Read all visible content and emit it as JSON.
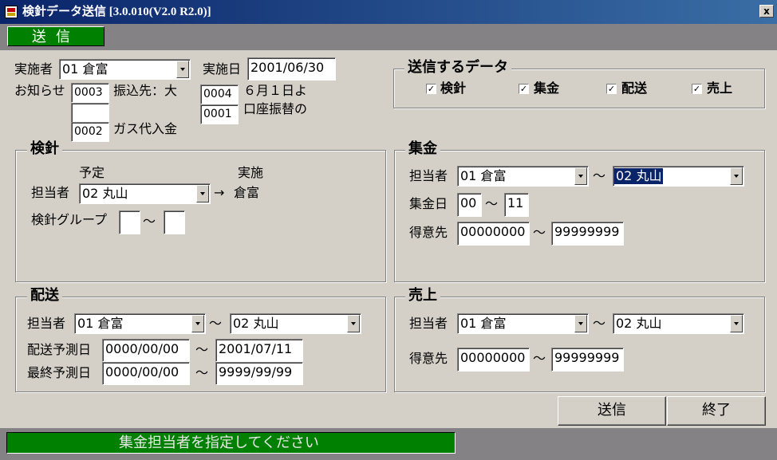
{
  "window": {
    "title": "検針データ送信 [3.0.010(V2.0 R2.0)]",
    "close_label": "x"
  },
  "toolbar": {
    "tab_label": "送信"
  },
  "header": {
    "executor_label": "実施者",
    "executor_value": "01 倉富",
    "date_label": "実施日",
    "date_value": "2001/06/30",
    "notice_label": "お知らせ",
    "notices": [
      {
        "code": "0003",
        "text": "振込先：大"
      },
      {
        "code": "",
        "text": ""
      },
      {
        "code": "0002",
        "text": "ガス代入金"
      }
    ],
    "notices2": [
      {
        "code": "0004",
        "text": "６月１日よ"
      },
      {
        "code": "0001",
        "text": "口座振替の"
      }
    ]
  },
  "send_data": {
    "title": "送信するデータ",
    "items": [
      {
        "label": "検針",
        "checked": true
      },
      {
        "label": "集金",
        "checked": true
      },
      {
        "label": "配送",
        "checked": true
      },
      {
        "label": "売上",
        "checked": true
      }
    ]
  },
  "kenshin": {
    "title": "検針",
    "planned_label": "予定",
    "actual_label": "実施",
    "staff_label": "担当者",
    "staff_value": "02 丸山",
    "arrow": "→",
    "actual_value": "倉富",
    "group_label": "検針グループ",
    "group_from": "",
    "group_to": "",
    "tilde": "～"
  },
  "shukin": {
    "title": "集金",
    "staff_label": "担当者",
    "staff_from": "01 倉富",
    "staff_to": "02 丸山",
    "day_label": "集金日",
    "day_from": "00",
    "day_to": "11",
    "customer_label": "得意先",
    "customer_from": "00000000",
    "customer_to": "99999999",
    "tilde": "～"
  },
  "haiso": {
    "title": "配送",
    "staff_label": "担当者",
    "staff_from": "01 倉富",
    "staff_to": "02 丸山",
    "forecast_label": "配送予測日",
    "forecast_from": "0000/00/00",
    "forecast_to": "2001/07/11",
    "final_label": "最終予測日",
    "final_from": "0000/00/00",
    "final_to": "9999/99/99",
    "tilde": "～"
  },
  "uriage": {
    "title": "売上",
    "staff_label": "担当者",
    "staff_from": "01 倉富",
    "staff_to": "02 丸山",
    "customer_label": "得意先",
    "customer_from": "00000000",
    "customer_to": "99999999",
    "tilde": "～"
  },
  "buttons": {
    "send": "送信",
    "exit": "終了"
  },
  "status": {
    "message": "集金担当者を指定してください"
  }
}
